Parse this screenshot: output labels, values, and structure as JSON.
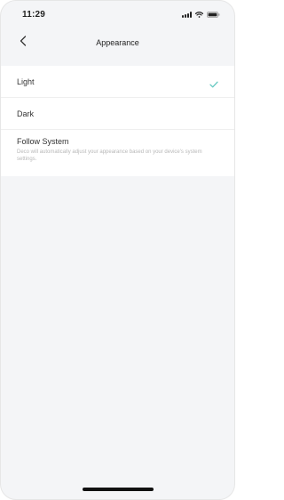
{
  "status_bar": {
    "time": "11:29"
  },
  "nav": {
    "title": "Appearance"
  },
  "options": {
    "light": {
      "label": "Light",
      "selected": true
    },
    "dark": {
      "label": "Dark",
      "selected": false
    },
    "follow": {
      "label": "Follow System",
      "description": "Deco will automatically adjust your appearance based on your device's system settings.",
      "selected": false
    }
  },
  "colors": {
    "accent_check": "#63c8c0",
    "background": "#f4f5f7"
  },
  "icons": {
    "back": "chevron-left-icon",
    "check": "check-icon",
    "signal": "signal-icon",
    "wifi": "wifi-icon",
    "battery": "battery-icon"
  }
}
